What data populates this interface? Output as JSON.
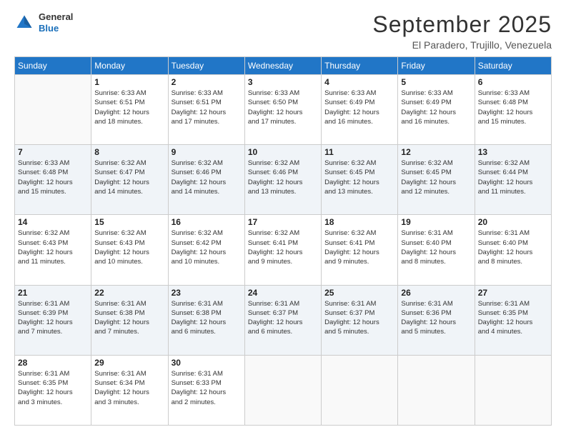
{
  "logo": {
    "general": "General",
    "blue": "Blue"
  },
  "header": {
    "month": "September 2025",
    "location": "El Paradero, Trujillo, Venezuela"
  },
  "days_of_week": [
    "Sunday",
    "Monday",
    "Tuesday",
    "Wednesday",
    "Thursday",
    "Friday",
    "Saturday"
  ],
  "weeks": [
    [
      {
        "day": "",
        "info": ""
      },
      {
        "day": "1",
        "info": "Sunrise: 6:33 AM\nSunset: 6:51 PM\nDaylight: 12 hours\nand 18 minutes."
      },
      {
        "day": "2",
        "info": "Sunrise: 6:33 AM\nSunset: 6:51 PM\nDaylight: 12 hours\nand 17 minutes."
      },
      {
        "day": "3",
        "info": "Sunrise: 6:33 AM\nSunset: 6:50 PM\nDaylight: 12 hours\nand 17 minutes."
      },
      {
        "day": "4",
        "info": "Sunrise: 6:33 AM\nSunset: 6:49 PM\nDaylight: 12 hours\nand 16 minutes."
      },
      {
        "day": "5",
        "info": "Sunrise: 6:33 AM\nSunset: 6:49 PM\nDaylight: 12 hours\nand 16 minutes."
      },
      {
        "day": "6",
        "info": "Sunrise: 6:33 AM\nSunset: 6:48 PM\nDaylight: 12 hours\nand 15 minutes."
      }
    ],
    [
      {
        "day": "7",
        "info": "Sunrise: 6:33 AM\nSunset: 6:48 PM\nDaylight: 12 hours\nand 15 minutes."
      },
      {
        "day": "8",
        "info": "Sunrise: 6:32 AM\nSunset: 6:47 PM\nDaylight: 12 hours\nand 14 minutes."
      },
      {
        "day": "9",
        "info": "Sunrise: 6:32 AM\nSunset: 6:46 PM\nDaylight: 12 hours\nand 14 minutes."
      },
      {
        "day": "10",
        "info": "Sunrise: 6:32 AM\nSunset: 6:46 PM\nDaylight: 12 hours\nand 13 minutes."
      },
      {
        "day": "11",
        "info": "Sunrise: 6:32 AM\nSunset: 6:45 PM\nDaylight: 12 hours\nand 13 minutes."
      },
      {
        "day": "12",
        "info": "Sunrise: 6:32 AM\nSunset: 6:45 PM\nDaylight: 12 hours\nand 12 minutes."
      },
      {
        "day": "13",
        "info": "Sunrise: 6:32 AM\nSunset: 6:44 PM\nDaylight: 12 hours\nand 11 minutes."
      }
    ],
    [
      {
        "day": "14",
        "info": "Sunrise: 6:32 AM\nSunset: 6:43 PM\nDaylight: 12 hours\nand 11 minutes."
      },
      {
        "day": "15",
        "info": "Sunrise: 6:32 AM\nSunset: 6:43 PM\nDaylight: 12 hours\nand 10 minutes."
      },
      {
        "day": "16",
        "info": "Sunrise: 6:32 AM\nSunset: 6:42 PM\nDaylight: 12 hours\nand 10 minutes."
      },
      {
        "day": "17",
        "info": "Sunrise: 6:32 AM\nSunset: 6:41 PM\nDaylight: 12 hours\nand 9 minutes."
      },
      {
        "day": "18",
        "info": "Sunrise: 6:32 AM\nSunset: 6:41 PM\nDaylight: 12 hours\nand 9 minutes."
      },
      {
        "day": "19",
        "info": "Sunrise: 6:31 AM\nSunset: 6:40 PM\nDaylight: 12 hours\nand 8 minutes."
      },
      {
        "day": "20",
        "info": "Sunrise: 6:31 AM\nSunset: 6:40 PM\nDaylight: 12 hours\nand 8 minutes."
      }
    ],
    [
      {
        "day": "21",
        "info": "Sunrise: 6:31 AM\nSunset: 6:39 PM\nDaylight: 12 hours\nand 7 minutes."
      },
      {
        "day": "22",
        "info": "Sunrise: 6:31 AM\nSunset: 6:38 PM\nDaylight: 12 hours\nand 7 minutes."
      },
      {
        "day": "23",
        "info": "Sunrise: 6:31 AM\nSunset: 6:38 PM\nDaylight: 12 hours\nand 6 minutes."
      },
      {
        "day": "24",
        "info": "Sunrise: 6:31 AM\nSunset: 6:37 PM\nDaylight: 12 hours\nand 6 minutes."
      },
      {
        "day": "25",
        "info": "Sunrise: 6:31 AM\nSunset: 6:37 PM\nDaylight: 12 hours\nand 5 minutes."
      },
      {
        "day": "26",
        "info": "Sunrise: 6:31 AM\nSunset: 6:36 PM\nDaylight: 12 hours\nand 5 minutes."
      },
      {
        "day": "27",
        "info": "Sunrise: 6:31 AM\nSunset: 6:35 PM\nDaylight: 12 hours\nand 4 minutes."
      }
    ],
    [
      {
        "day": "28",
        "info": "Sunrise: 6:31 AM\nSunset: 6:35 PM\nDaylight: 12 hours\nand 3 minutes."
      },
      {
        "day": "29",
        "info": "Sunrise: 6:31 AM\nSunset: 6:34 PM\nDaylight: 12 hours\nand 3 minutes."
      },
      {
        "day": "30",
        "info": "Sunrise: 6:31 AM\nSunset: 6:33 PM\nDaylight: 12 hours\nand 2 minutes."
      },
      {
        "day": "",
        "info": ""
      },
      {
        "day": "",
        "info": ""
      },
      {
        "day": "",
        "info": ""
      },
      {
        "day": "",
        "info": ""
      }
    ]
  ]
}
